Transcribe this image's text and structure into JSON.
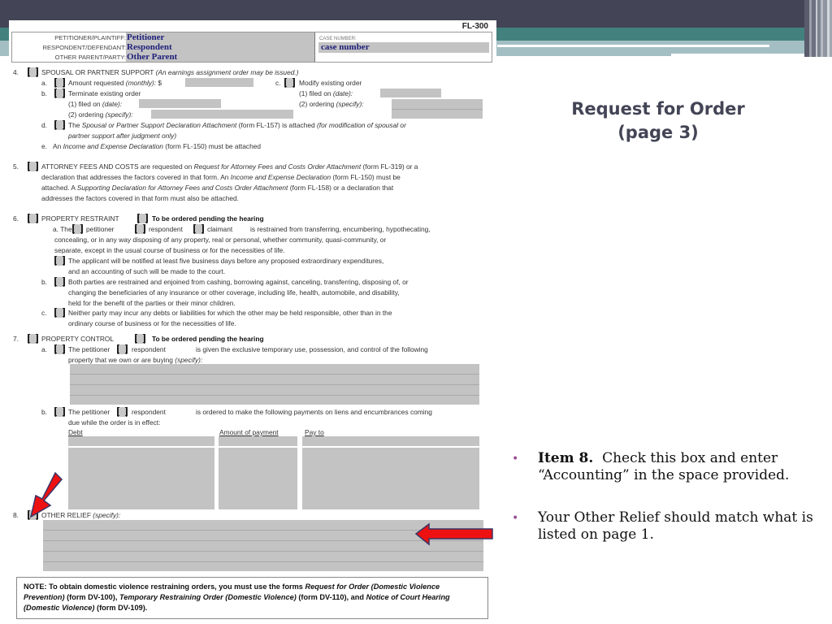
{
  "slide": {
    "title_line1": "Request for Order",
    "title_line2": "(page 3)",
    "bullets": [
      {
        "bold": "Item 8.",
        "text": "Check this box and enter “Accounting” in the space provided."
      },
      {
        "bold": "",
        "text": "Your Other Relief should match what is listed on page 1."
      }
    ],
    "colors": {
      "header_dark": "#434556",
      "header_teal": "#43817e",
      "header_light": "#a3bfc3",
      "bullet": "#9b4f96",
      "arrow": "#ee1111"
    }
  },
  "form": {
    "form_id": "FL-300",
    "caption": {
      "petitioner_label": "PETITIONER/PLAINTIFF:",
      "petitioner_value": "Petitioner",
      "respondent_label": "RESPONDENT/DEFENDANT:",
      "respondent_value": "Respondent",
      "other_label": "OTHER PARENT/PARTY:",
      "other_value": "Other Parent",
      "case_number_label": "CASE NUMBER:",
      "case_number_value": "case number"
    },
    "item4": {
      "num": "4.",
      "title": "SPOUSAL OR PARTNER SUPPORT",
      "title_note": "(An earnings assignment order may be issued.)",
      "a_letter": "a.",
      "a_text": "Amount requested",
      "a_italic": "(monthly):",
      "a_dollar": "$",
      "b_letter": "b.",
      "b_text": "Terminate existing order",
      "b1_text": "(1)  filed on",
      "b1_italic": "(date):",
      "b2_text": "(2)  ordering",
      "b2_italic": "(specify):",
      "c_letter": "c.",
      "c_text": "Modify existing order",
      "c1_text": "(1)  filed on",
      "c1_italic": "(date):",
      "c2_text": "(2)  ordering",
      "c2_italic": "(specify):",
      "d_letter": "d.",
      "d_text1": "The",
      "d_italic1": "Spousal or Partner Support Declaration Attachment",
      "d_text2": "(form FL-157) is attached",
      "d_italic2": "(for modification of spousal or",
      "d_italic3": "partner support after judgment only)",
      "e_letter": "e.",
      "e_text1": "An",
      "e_italic": "Income and Expense Declaration",
      "e_text2": "(form FL-150) must be attached"
    },
    "item5": {
      "num": "5.",
      "line1a": "ATTORNEY FEES AND COSTS are requested on",
      "line1i": "Request for Attorney Fees and Costs Order Attachment",
      "line1b": "(form FL-319) or a",
      "line2a": "declaration that addresses the factors covered in that form. An",
      "line2i": "Income and Expense Declaration",
      "line2b": "(form FL-150) must be",
      "line3a": "attached. A",
      "line3i": "Supporting Declaration for Attorney Fees and Costs Order Attachment",
      "line3b": "(form FL-158) or a declaration that",
      "line4": "addresses the factors covered in that form must also be attached."
    },
    "item6": {
      "num": "6.",
      "title": "PROPERTY RESTRAINT",
      "pending": "To be ordered pending the hearing",
      "a_letter": "a.",
      "a_the": "The",
      "a_petitioner": "petitioner",
      "a_respondent": "respondent",
      "a_claimant": "claimant",
      "a_line1": "is restrained from transferring, encumbering, hypothecating,",
      "a_line2": "concealing, or in any way disposing of any property, real or personal, whether community, quasi-community, or",
      "a_line3": "separate, except in the usual course of business or for the necessities of life.",
      "a_sub1": "The applicant will be notified at least five business days before any proposed extraordinary expenditures,",
      "a_sub2": "and an accounting of such will be made to the court.",
      "b_letter": "b.",
      "b_line1": "Both parties are restrained and enjoined from cashing, borrowing against, canceling, transferring, disposing of, or",
      "b_line2": "changing the beneficiaries of any insurance or other coverage, including life, health, automobile, and disability,",
      "b_line3": "held for the benefit of the parties or their minor children.",
      "c_letter": "c.",
      "c_line1": "Neither party may incur any debts or liabilities for which the other may be held responsible, other than in the",
      "c_line2": "ordinary course of business or for the necessities of life."
    },
    "item7": {
      "num": "7.",
      "title": "PROPERTY CONTROL",
      "pending": "To be ordered pending the hearing",
      "a_letter": "a.",
      "a_petitioner": "The petitioner",
      "a_respondent": "respondent",
      "a_line1": "is given the exclusive temporary use, possession, and control of the following",
      "a_line2": "property that we own or are buying",
      "a_italic": "(specify):",
      "b_letter": "b.",
      "b_petitioner": "The petitioner",
      "b_respondent": "respondent",
      "b_line1": "is ordered to make the following payments on liens and encumbrances coming",
      "b_line2": "due while the order is in effect:",
      "columns": [
        "Debt",
        "Amount of payment",
        "Pay to"
      ]
    },
    "item8": {
      "num": "8.",
      "title": "OTHER RELIEF",
      "italic": "(specify):",
      "value": ""
    },
    "note": {
      "p1": "NOTE: To obtain domestic violence restraining orders, you must use the forms ",
      "i1": "Request for Order (Domestic Violence Prevention)",
      "p2": " (form DV-100), ",
      "i2": "Temporary Restraining Order (Domestic Violence)",
      "p3": " (form DV-110), and ",
      "i3": "Notice of Court Hearing (Domestic Violence)",
      "p4": " (form DV-109)."
    }
  }
}
